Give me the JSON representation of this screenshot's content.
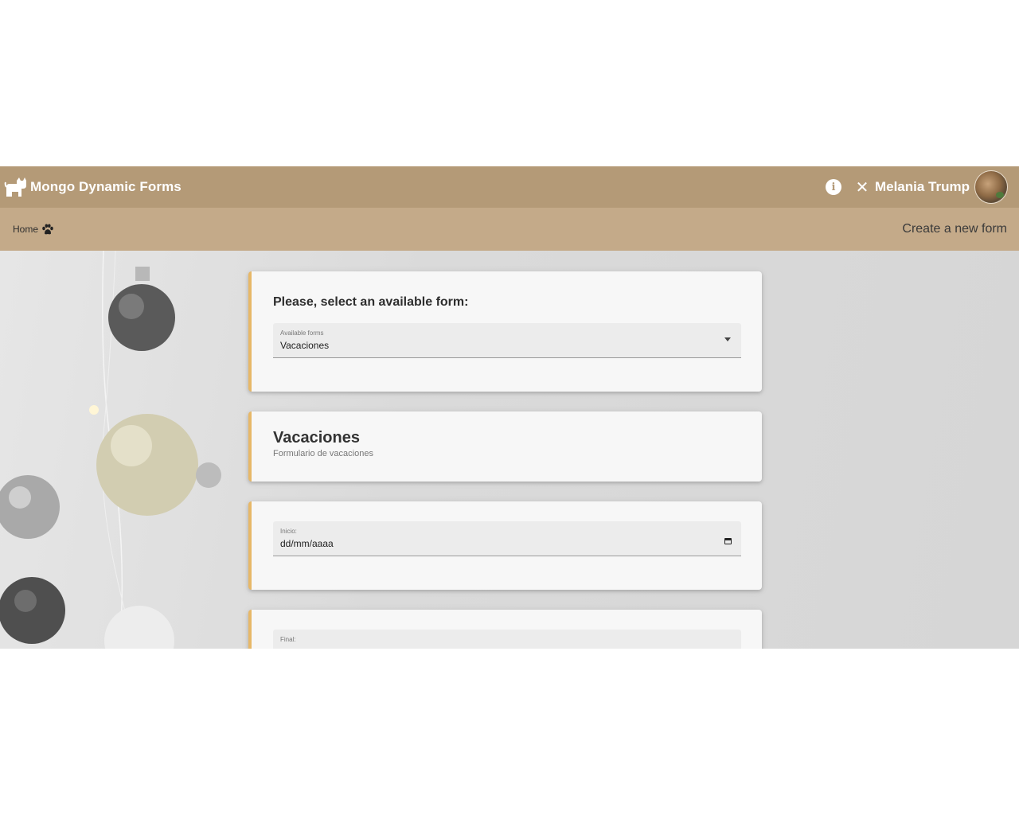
{
  "header": {
    "app_title": "Mongo Dynamic Forms",
    "logo_icon": "cat-icon",
    "info_icon": "info-icon",
    "close_symbol": "✕",
    "user_name": "Melania Trump",
    "colors": {
      "topbar": "#b49a77",
      "subbar": "#c4aa89",
      "accent": "#e7b868"
    }
  },
  "subheader": {
    "breadcrumb_home": "Home",
    "breadcrumb_icon": "paw-icon",
    "create_link": "Create a new form"
  },
  "select_card": {
    "heading": "Please, select an available form:",
    "field_label": "Available forms",
    "selected_value": "Vacaciones"
  },
  "form_header": {
    "title": "Vacaciones",
    "description": "Formulario de vacaciones"
  },
  "fields": {
    "start": {
      "label": "Inicio:",
      "placeholder": "dd/mm/aaaa"
    },
    "end": {
      "label": "Final:"
    }
  }
}
